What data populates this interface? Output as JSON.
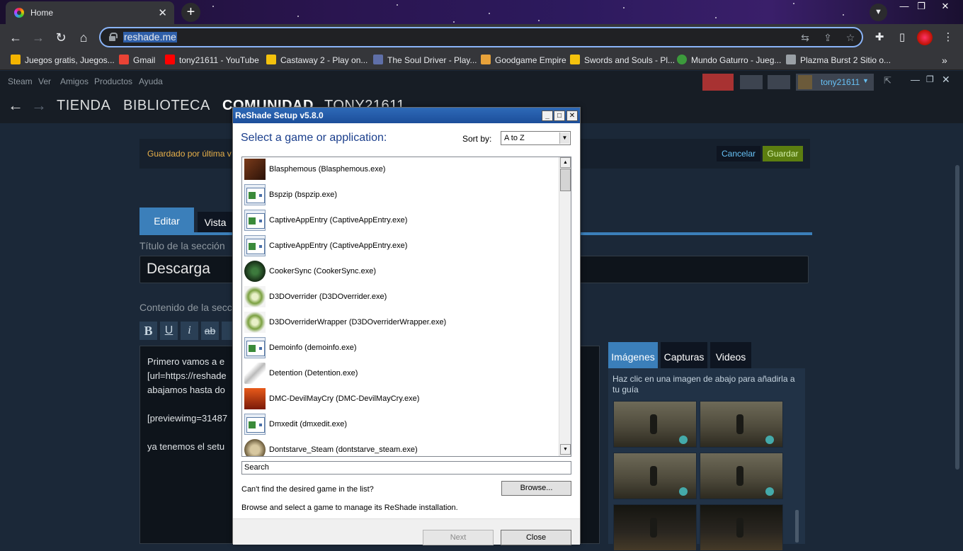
{
  "chrome": {
    "tab_title": "Home",
    "url": "reshade.me",
    "bookmarks": [
      {
        "label": "Juegos gratis, Juegos...",
        "color": "#f4b400"
      },
      {
        "label": "Gmail",
        "color": "#ea4335"
      },
      {
        "label": "tony21611 - YouTube",
        "color": "#ff0000"
      },
      {
        "label": "Castaway 2 - Play on...",
        "color": "#f4c20d"
      },
      {
        "label": "The Soul Driver - Play...",
        "color": "#5f6fa8"
      },
      {
        "label": "Goodgame Empire",
        "color": "#e8a23a"
      },
      {
        "label": "Swords and Souls - Pl...",
        "color": "#f4c20d"
      },
      {
        "label": "Mundo Gaturro - Jueg...",
        "color": "#3c9a3c"
      },
      {
        "label": "Plazma Burst 2 Sitio o...",
        "color": "#9aa0a6"
      }
    ]
  },
  "steam": {
    "menu": [
      "Steam",
      "Ver",
      "Amigos",
      "Productos",
      "Ayuda"
    ],
    "nav": [
      "TIENDA",
      "BIBLIOTECA",
      "COMUNIDAD",
      "TONY21611"
    ],
    "username": "tony21611",
    "save_message": "Guardado por última v",
    "cancel_label": "Cancelar",
    "save_label": "Guardar",
    "tab_edit": "Editar",
    "tab_view": "Vista",
    "section_title_label": "Título de la sección",
    "section_title_value": "Descarga",
    "content_label": "Contenido de la secc",
    "format_buttons": [
      "B",
      "U",
      "i",
      "ab"
    ],
    "content_lines": [
      "Primero vamos a e",
      "[url=https://reshade",
      "abajamos hasta do",
      "",
      "[previewimg=31487",
      "",
      "ya tenemos el setu"
    ],
    "media_tabs": [
      "Imágenes",
      "Capturas",
      "Videos"
    ],
    "media_hint": "Haz clic en una imagen de abajo para añadirla a tu guía"
  },
  "dialog": {
    "title": "ReShade Setup v5.8.0",
    "heading": "Select a game or application:",
    "sort_label": "Sort by:",
    "sort_value": "A to Z",
    "games": [
      {
        "label": "Blasphemous (Blasphemous.exe)",
        "icon": "blasphemous-icon"
      },
      {
        "label": "Bspzip (bspzip.exe)",
        "icon": "exe-icon"
      },
      {
        "label": "CaptiveAppEntry (CaptiveAppEntry.exe)",
        "icon": "exe-icon"
      },
      {
        "label": "CaptiveAppEntry (CaptiveAppEntry.exe)",
        "icon": "exe-icon"
      },
      {
        "label": "CookerSync (CookerSync.exe)",
        "icon": "unreal-icon"
      },
      {
        "label": "D3DOverrider (D3DOverrider.exe)",
        "icon": "d3d-icon"
      },
      {
        "label": "D3DOverriderWrapper (D3DOverriderWrapper.exe)",
        "icon": "d3d-icon"
      },
      {
        "label": "Demoinfo (demoinfo.exe)",
        "icon": "exe-icon"
      },
      {
        "label": "Detention (Detention.exe)",
        "icon": "plane-icon"
      },
      {
        "label": "DMC-DevilMayCry (DMC-DevilMayCry.exe)",
        "icon": "dmc-icon"
      },
      {
        "label": "Dmxedit (dmxedit.exe)",
        "icon": "exe-icon"
      },
      {
        "label": "Dontstarve_Steam (dontstarve_steam.exe)",
        "icon": "dontstarve-icon"
      }
    ],
    "search_placeholder": "Search",
    "cant_find": "Can't find the desired game in the list?",
    "browse_label": "Browse...",
    "description": "Browse and select a game to manage its ReShade installation.",
    "next_label": "Next",
    "close_label": "Close"
  }
}
